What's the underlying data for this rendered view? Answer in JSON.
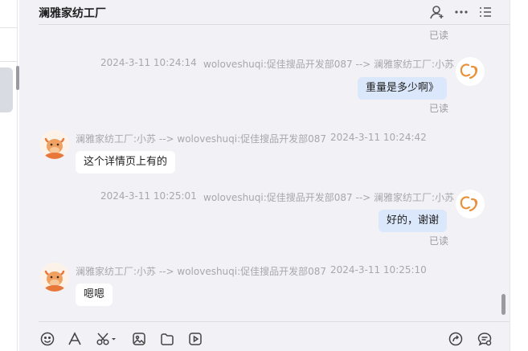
{
  "header": {
    "title": "澜雅家纺工厂",
    "icons": [
      "add-contact-icon",
      "more-icon",
      "list-menu-icon"
    ]
  },
  "messages": [
    {
      "type": "status",
      "status": "已读"
    },
    {
      "from": "me",
      "time": "2024-3-11 10:24:14",
      "route": "woloveshuqi:促佳搜品开发部087 --> 澜雅家纺工厂:小苏",
      "text": "重量是多少啊》",
      "status": "已读"
    },
    {
      "from": "other",
      "route": "澜雅家纺工厂:小苏 --> woloveshuqi:促佳搜品开发部087",
      "time": "2024-3-11 10:24:42",
      "text": "这个详情页上有的"
    },
    {
      "from": "me",
      "time": "2024-3-11 10:25:01",
      "route": "woloveshuqi:促佳搜品开发部087 --> 澜雅家纺工厂:小苏",
      "text": "好的，谢谢",
      "status": "已读"
    },
    {
      "from": "other",
      "route": "澜雅家纺工厂:小苏 --> woloveshuqi:促佳搜品开发部087",
      "time": "2024-3-11 10:25:10",
      "text": "嗯嗯"
    }
  ],
  "toolbar": {
    "icons": [
      "emoji-icon",
      "font-icon",
      "scissors-icon",
      "image-icon",
      "file-icon",
      "video-icon",
      "share-icon",
      "chat-settings-icon"
    ]
  }
}
